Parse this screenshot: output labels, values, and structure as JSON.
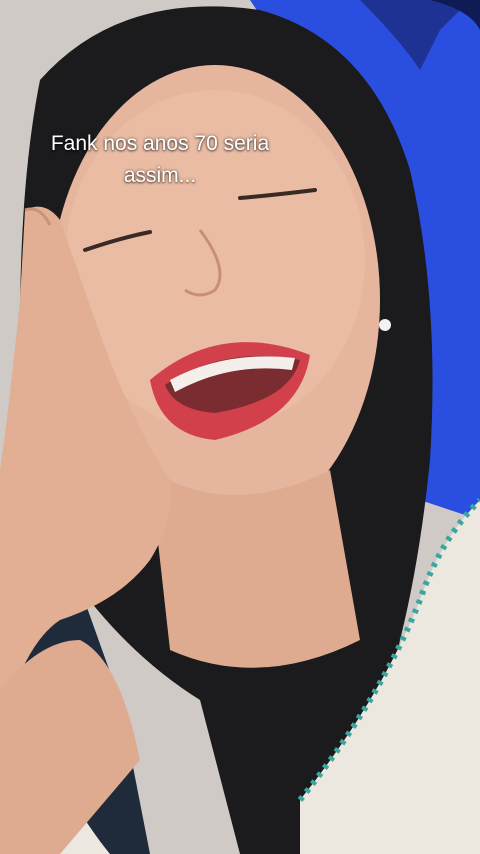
{
  "video": {
    "caption_lines": [
      "Fank nos anos 70 seria",
      "assim..."
    ]
  },
  "scene": {
    "description_icons": [
      "face-illustration",
      "hand-illustration",
      "pillow-illustration"
    ],
    "colors": {
      "pillow": "#2a4fe0",
      "hair": "#1b1a1d",
      "skin": "#e6b59d",
      "lips": "#d2404c",
      "shirt": "#ece7df",
      "trim": "#3aa6a0"
    }
  }
}
